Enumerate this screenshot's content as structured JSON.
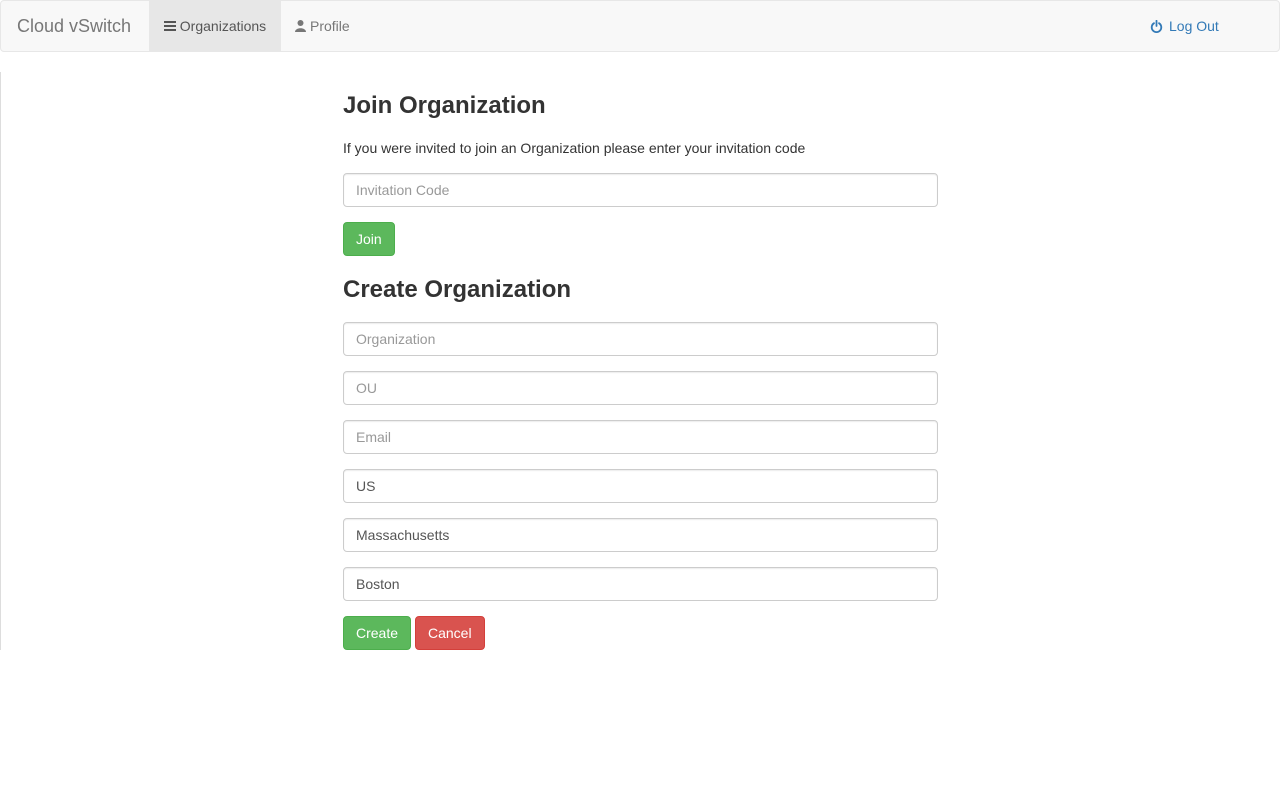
{
  "navbar": {
    "brand": "Cloud vSwitch",
    "organizations_label": "Organizations",
    "profile_label": "Profile",
    "logout_label": "Log Out"
  },
  "join": {
    "title": "Join Organization",
    "help_text": "If you were invited to join an Organization please enter your invitation code",
    "invitation_placeholder": "Invitation Code",
    "invitation_value": "",
    "join_label": "Join"
  },
  "create": {
    "title": "Create Organization",
    "organization": {
      "placeholder": "Organization",
      "value": ""
    },
    "ou": {
      "placeholder": "OU",
      "value": ""
    },
    "email": {
      "placeholder": "Email",
      "value": ""
    },
    "country": {
      "placeholder": "",
      "value": "US"
    },
    "state": {
      "placeholder": "",
      "value": "Massachusetts"
    },
    "city": {
      "placeholder": "",
      "value": "Boston"
    },
    "create_label": "Create",
    "cancel_label": "Cancel"
  },
  "colors": {
    "success": "#5cb85c",
    "danger": "#d9534f",
    "link": "#337ab7"
  }
}
